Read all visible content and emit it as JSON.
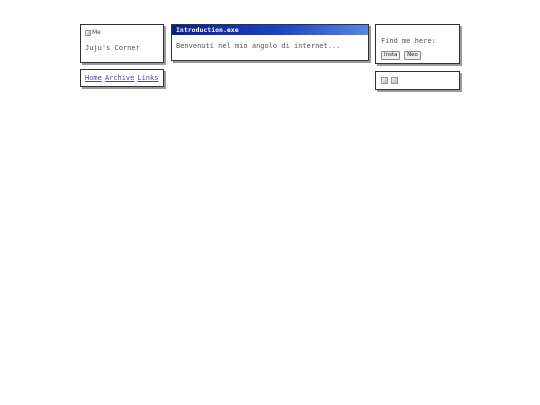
{
  "profile": {
    "avatar_alt": "Me",
    "site_name": "Juju's Corner"
  },
  "nav": {
    "items": [
      "Home",
      "Archive",
      "Links"
    ]
  },
  "window": {
    "title": "Introduction.exe",
    "content": "Benvenuti nel mio angolo di internet..."
  },
  "social": {
    "label": "Find me here:",
    "buttons": [
      "Insta",
      "Neo"
    ]
  },
  "badges": {
    "icons": [
      "broken-image-icon",
      "broken-image-icon"
    ]
  },
  "colors": {
    "titlebar_start": "#0a1f8c",
    "titlebar_end": "#5a86e0",
    "link": "#4a4aa8",
    "border": "#333333"
  }
}
